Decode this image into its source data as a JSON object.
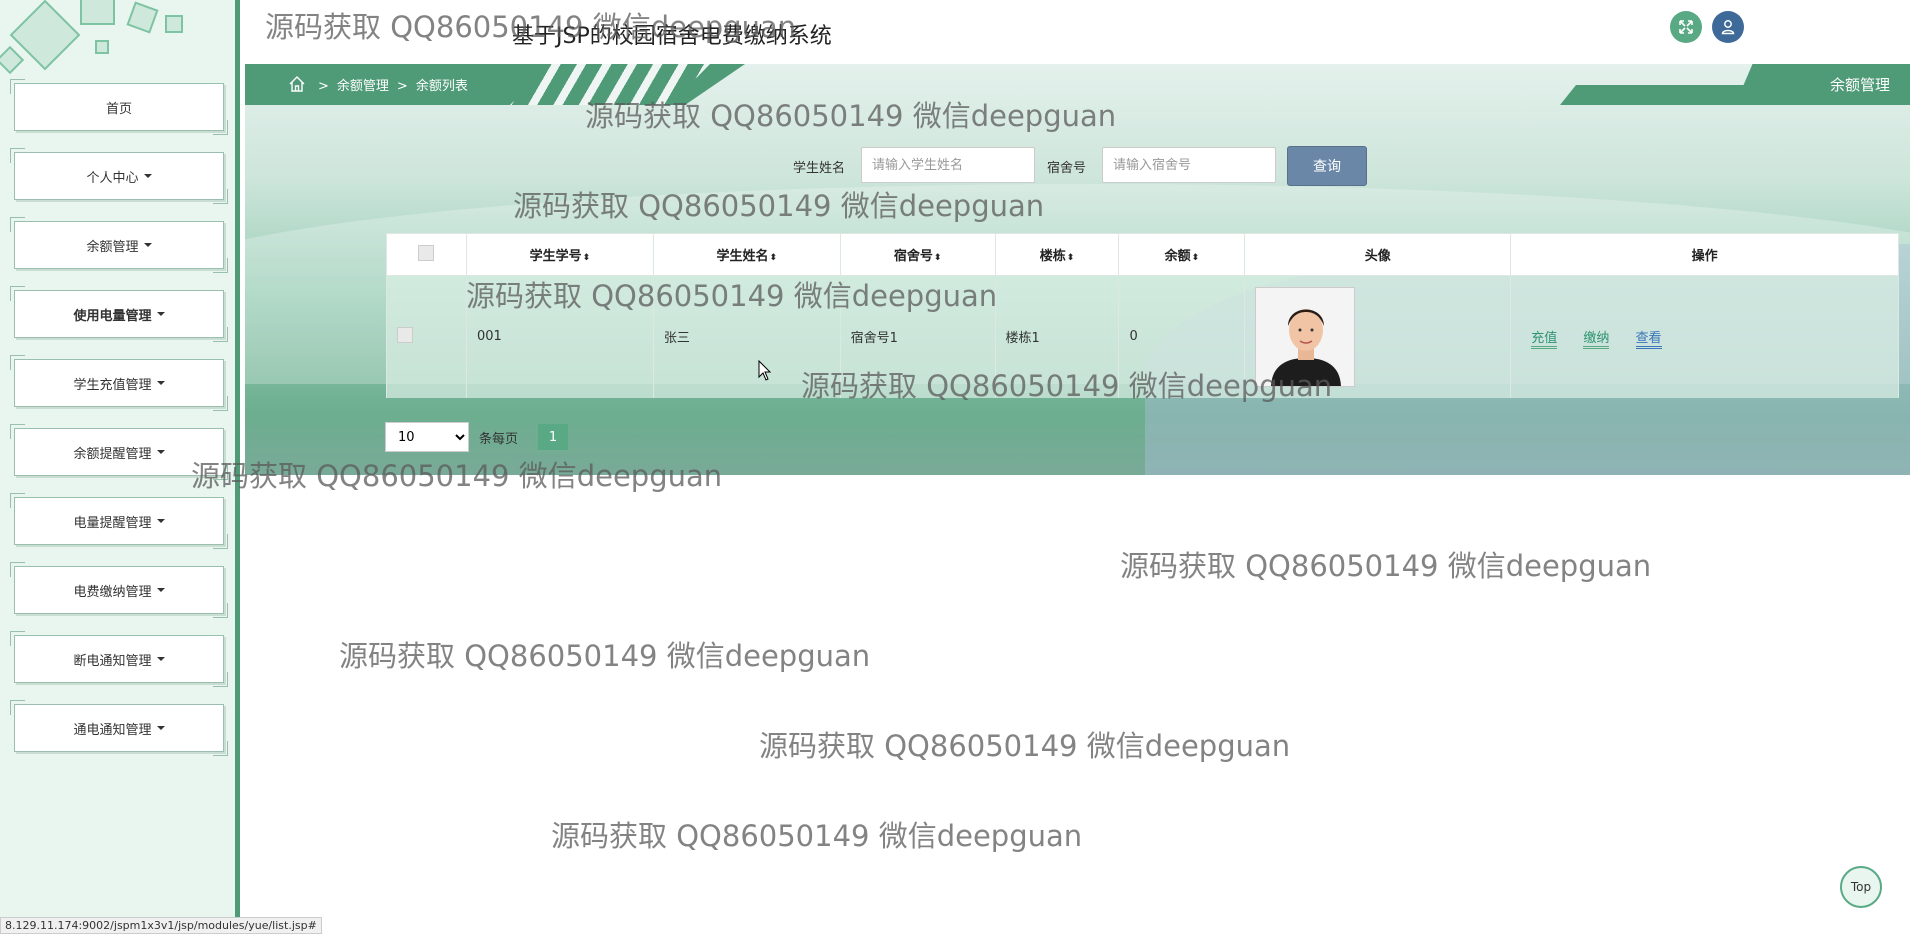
{
  "app": {
    "title": "基于JSP的校园宿舍电费缴纳系统"
  },
  "sidebar": {
    "items": [
      {
        "label": "首页",
        "has_caret": false
      },
      {
        "label": "个人中心",
        "has_caret": true
      },
      {
        "label": "余额管理",
        "has_caret": true
      },
      {
        "label": "使用电量管理",
        "has_caret": true
      },
      {
        "label": "学生充值管理",
        "has_caret": true
      },
      {
        "label": "余额提醒管理",
        "has_caret": true
      },
      {
        "label": "电量提醒管理",
        "has_caret": true
      },
      {
        "label": "电费缴纳管理",
        "has_caret": true
      },
      {
        "label": "断电通知管理",
        "has_caret": true
      },
      {
        "label": "通电通知管理",
        "has_caret": true
      }
    ]
  },
  "breadcrumb": {
    "level1": "余额管理",
    "level2": "余额列表",
    "separator": ">"
  },
  "section_tab": "余额管理",
  "search": {
    "name_label": "学生姓名",
    "name_placeholder": "请输入学生姓名",
    "dorm_label": "宿舍号",
    "dorm_placeholder": "请输入宿舍号",
    "button": "查询"
  },
  "table": {
    "headers": {
      "student_id": "学生学号",
      "student_name": "学生姓名",
      "dorm": "宿舍号",
      "building": "楼栋",
      "balance": "余额",
      "avatar": "头像",
      "actions": "操作"
    },
    "sort_icon": "⬍",
    "rows": [
      {
        "student_id": "001",
        "student_name": "张三",
        "dorm": "宿舍号1",
        "building": "楼栋1",
        "balance": "0"
      }
    ],
    "actions": {
      "recharge": "充值",
      "pay": "缴纳",
      "view": "查看"
    }
  },
  "pager": {
    "page_size": "10",
    "per_page_label": "条每页",
    "current_page": "1"
  },
  "watermark": "源码获取 QQ86050149 微信deepguan",
  "top_button": "Top",
  "status_url": "8.129.11.174:9002/jspm1x3v1/jsp/modules/yue/list.jsp#",
  "colors": {
    "accent_green": "#4f9a77",
    "sidebar_bg": "#e8f6ef",
    "search_button": "#6a87a8",
    "link_view": "#3a76b8"
  },
  "icons": {
    "home": "home-icon",
    "expand": "expand-icon",
    "user": "user-icon"
  }
}
